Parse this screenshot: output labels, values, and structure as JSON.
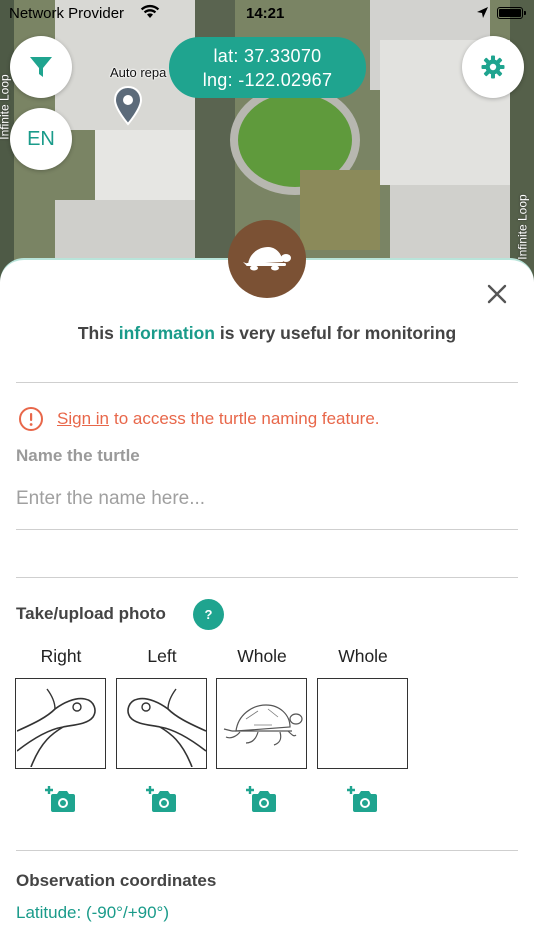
{
  "status_bar": {
    "carrier": "Network Provider",
    "time": "14:21"
  },
  "map": {
    "coordinates": {
      "lat_label": "lat: 37.33070",
      "lng_label": "lng: -122.02967"
    },
    "place_label": "Auto repa",
    "road_label_left": "Infinite Loop",
    "road_label_right": "Infinite Loop",
    "lang_button": "EN"
  },
  "sheet": {
    "intro_prefix": "This",
    "intro_highlight": "information",
    "intro_suffix": "is very useful for monitoring",
    "signin_link": "Sign in",
    "signin_rest": "to access the turtle naming feature.",
    "name_label": "Name the turtle",
    "name_placeholder": "Enter the name here...",
    "photo_label": "Take/upload photo",
    "help_label": "?",
    "photos": [
      {
        "caption": "Right"
      },
      {
        "caption": "Left"
      },
      {
        "caption": "Whole"
      },
      {
        "caption": "Whole"
      }
    ],
    "coords_label": "Observation coordinates",
    "latitude_label": "Latitude: (-90°/+90°)"
  },
  "colors": {
    "accent": "#1fa48f",
    "accent_text": "#1a9b8a",
    "warning": "#e8674a",
    "turtle_badge": "#7b5134"
  }
}
